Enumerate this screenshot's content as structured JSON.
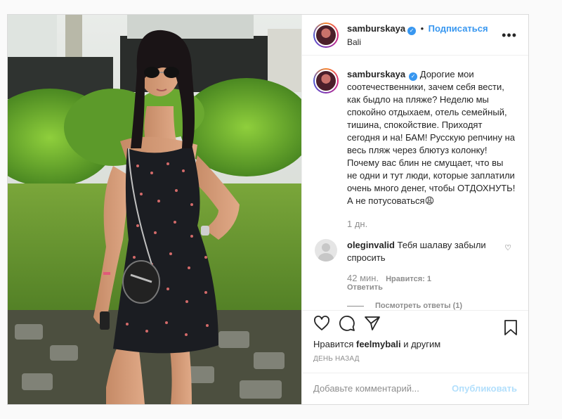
{
  "post": {
    "username": "samburskaya",
    "separator": "•",
    "follow_label": "Подписаться",
    "location": "Bali",
    "more_label": "•••",
    "verified_icon": "✓",
    "caption_username": "samburskaya",
    "caption_text": "Дорогие мои соотечественники, зачем себя вести, как быдло на пляже? Неделю мы спокойно отдыхаем, отель семейный, тишина, спокойствие. Приходят сегодня и на! БАМ! Русскую репчину на весь пляж через блютуз колонку! Почему вас блин не смущает, что вы не одни и тут люди, которые заплатили очень много денег, чтобы ОТДОХНУТЬ! А не потусоваться😩",
    "caption_time": "1 дн."
  },
  "comment": {
    "username": "oleginvalid",
    "text": "Тебя шалаву забыли спросить",
    "heart_icon": "♡",
    "time": "42 мин.",
    "likes": "Нравится: 1",
    "reply_label": "Ответить",
    "view_replies": "Посмотреть ответы (1)"
  },
  "actions": {
    "liked_by_prefix": "Нравится",
    "liked_by_user": "feelmybali",
    "liked_by_suffix": "и другим",
    "timestamp": "День назад"
  },
  "composer": {
    "placeholder": "Добавьте комментарий...",
    "publish_label": "Опубликовать"
  },
  "colors": {
    "accent": "#3897f0",
    "publish_disabled": "#b2dffc",
    "secondary_text": "#8e8e8e"
  },
  "icons": [
    "heart-icon",
    "comment-icon",
    "share-icon",
    "bookmark-icon",
    "more-icon",
    "verified-badge-icon"
  ]
}
